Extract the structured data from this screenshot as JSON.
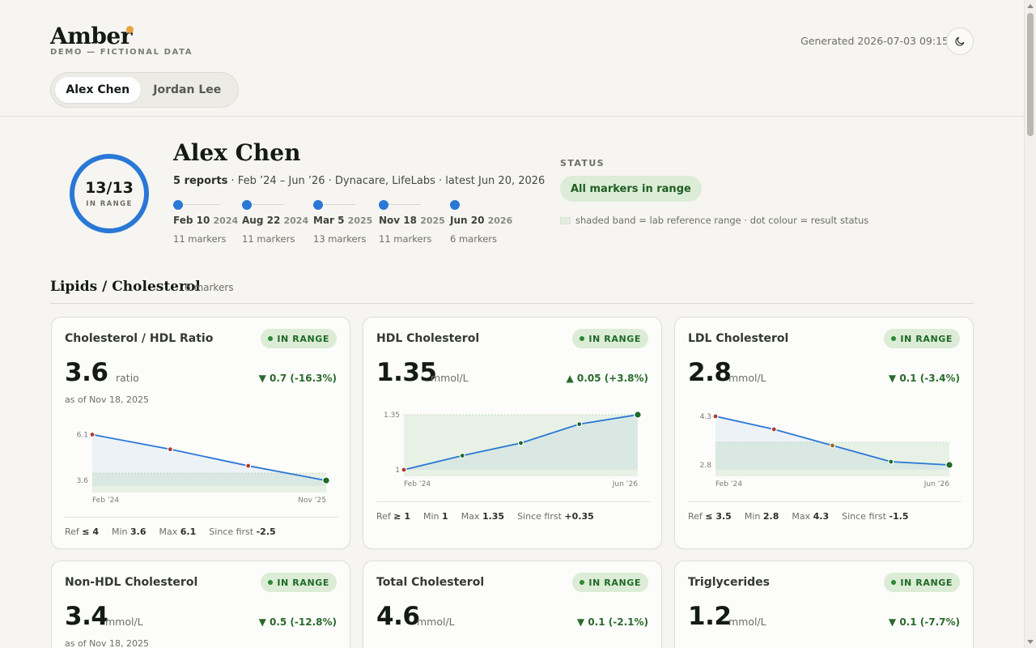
{
  "brand": {
    "name": "Amber",
    "subtitle": "DEMO — FICTIONAL DATA",
    "dot_color": "#e8a33a"
  },
  "header": {
    "generated": "Generated 2026-07-03 09:15",
    "theme_icon": "moon-icon"
  },
  "patients": [
    {
      "label": "Alex Chen",
      "active": true
    },
    {
      "label": "Jordan Lee",
      "active": false
    }
  ],
  "summary": {
    "ring_value": "13/13",
    "ring_label": "IN RANGE",
    "ring_fraction": 1.0,
    "name": "Alex Chen",
    "reports": "5 reports",
    "meta": " · Feb ’24 – Jun ’26 · Dynacare, LifeLabs · latest Jun 20, 2026",
    "timeline": [
      {
        "date": "Feb 10",
        "year": "2024",
        "count": "11 markers"
      },
      {
        "date": "Aug 22",
        "year": "2024",
        "count": "11 markers"
      },
      {
        "date": "Mar 5",
        "year": "2025",
        "count": "13 markers"
      },
      {
        "date": "Nov 18",
        "year": "2025",
        "count": "11 markers"
      },
      {
        "date": "Jun 20",
        "year": "2026",
        "count": "6 markers"
      }
    ],
    "status_label": "STATUS",
    "status_value": "All markers in range",
    "legend_note": "shaded band = lab reference range · dot colour = result status"
  },
  "section": {
    "title": "Lipids / Cholesterol",
    "count": "6 markers"
  },
  "colors": {
    "accent": "#2a78d6",
    "in_range": "#1f6a27",
    "band": "#e3eee0",
    "high": "#b03a2e",
    "borderline": "#9a6a10"
  },
  "cards": [
    {
      "title": "Cholesterol / HDL Ratio",
      "badge": "IN RANGE",
      "value": "3.6",
      "unit": "ratio",
      "delta": "▼ 0.7 (-16.3%)",
      "as_of": "as of Nov 18, 2025",
      "ref_label": "Ref",
      "ref": "≤ 4",
      "min_label": "Min",
      "min": "3.6",
      "max_label": "Max",
      "max": "6.1",
      "since_label": "Since first",
      "since": "-2.5",
      "chart_data": {
        "type": "line",
        "x_first": "Feb ’24",
        "x_last": "Nov ’25",
        "y_top_label": "6.1",
        "y_bottom_label": "3.6",
        "values": [
          6.1,
          5.3,
          4.4,
          3.6
        ],
        "ref_range": [
          null,
          4
        ],
        "ylim": [
          3.3,
          6.3
        ],
        "point_status": [
          "high",
          "high",
          "high",
          "in"
        ]
      }
    },
    {
      "title": "HDL Cholesterol",
      "badge": "IN RANGE",
      "value": "1.35",
      "unit": "mmol/L",
      "delta": "▲ 0.05 (+3.8%)",
      "as_of": "",
      "ref_label": "Ref",
      "ref": "≥ 1",
      "min_label": "Min",
      "min": "1",
      "max_label": "Max",
      "max": "1.35",
      "since_label": "Since first",
      "since": "+0.35",
      "chart_data": {
        "type": "line",
        "x_first": "Feb ’24",
        "x_last": "Jun ’26",
        "y_top_label": "1.35",
        "y_bottom_label": "1",
        "values": [
          1.0,
          1.09,
          1.17,
          1.29,
          1.35
        ],
        "ref_range": [
          1,
          null
        ],
        "ylim": [
          1.0,
          1.35
        ],
        "point_status": [
          "high",
          "in",
          "in",
          "in",
          "in"
        ]
      }
    },
    {
      "title": "LDL Cholesterol",
      "badge": "IN RANGE",
      "value": "2.8",
      "unit": "mmol/L",
      "delta": "▼ 0.1 (-3.4%)",
      "as_of": "",
      "ref_label": "Ref",
      "ref": "≤ 3.5",
      "min_label": "Min",
      "min": "2.8",
      "max_label": "Max",
      "max": "4.3",
      "since_label": "Since first",
      "since": "-1.5",
      "chart_data": {
        "type": "line",
        "x_first": "Feb ’24",
        "x_last": "Jun ’26",
        "y_top_label": "4.3",
        "y_bottom_label": "2.8",
        "values": [
          4.3,
          3.9,
          3.4,
          2.9,
          2.8
        ],
        "ref_range": [
          null,
          3.5
        ],
        "ylim": [
          2.65,
          4.35
        ],
        "point_status": [
          "high",
          "high",
          "borderline",
          "in",
          "in"
        ]
      }
    },
    {
      "title": "Non-HDL Cholesterol",
      "badge": "IN RANGE",
      "value": "3.4",
      "unit": "mmol/L",
      "delta": "▼ 0.5 (-12.8%)",
      "as_of": "as of Nov 18, 2025"
    },
    {
      "title": "Total Cholesterol",
      "badge": "IN RANGE",
      "value": "4.6",
      "unit": "mmol/L",
      "delta": "▼ 0.1 (-2.1%)",
      "as_of": ""
    },
    {
      "title": "Triglycerides",
      "badge": "IN RANGE",
      "value": "1.2",
      "unit": "mmol/L",
      "delta": "▼ 0.1 (-7.7%)",
      "as_of": ""
    }
  ]
}
